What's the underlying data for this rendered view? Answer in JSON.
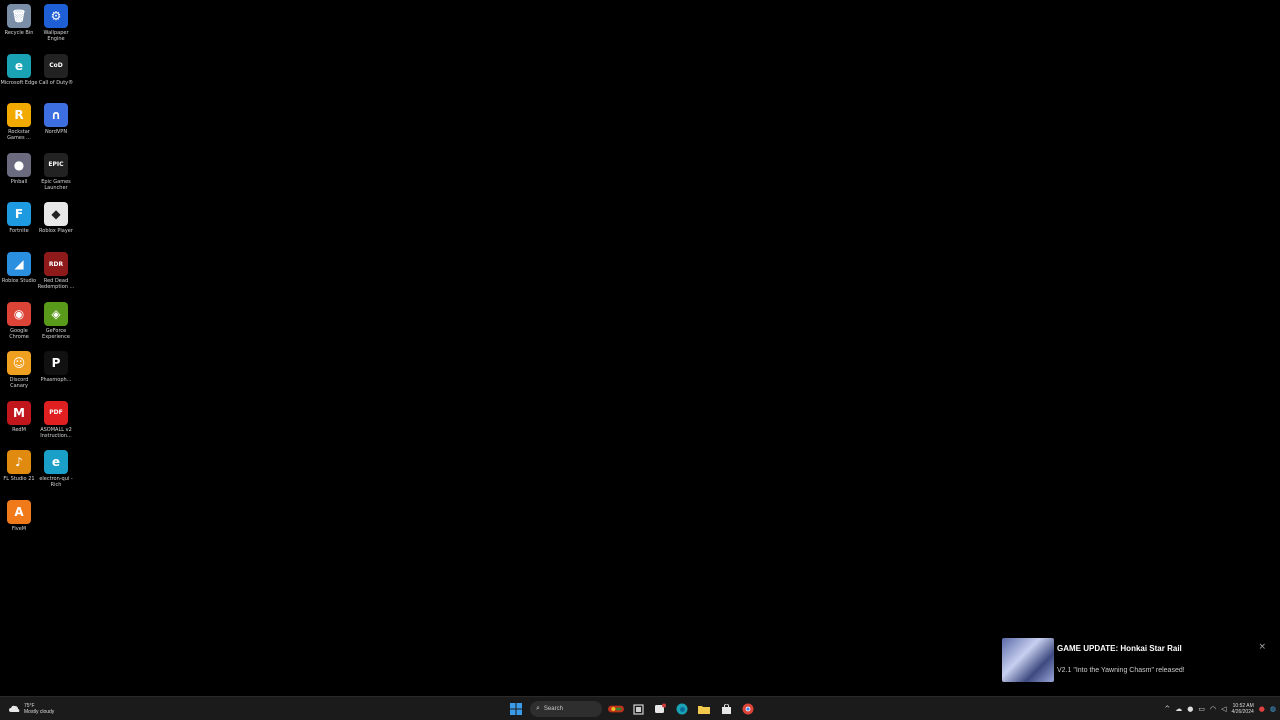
{
  "desktop": {
    "icons": [
      {
        "label": "Recycle Bin",
        "icon": "recycle-bin-icon",
        "glyph": "🗑",
        "color": "#7a8ea8"
      },
      {
        "label": "Wallpaper Engine",
        "icon": "wallpaper-engine-icon",
        "glyph": "⚙",
        "color": "#1f5fd6"
      },
      {
        "label": "Microsoft Edge",
        "icon": "edge-icon",
        "glyph": "e",
        "color": "#1aa3b5"
      },
      {
        "label": "Call of Duty®",
        "icon": "call-of-duty-icon",
        "glyph": "CoD",
        "color": "#222222"
      },
      {
        "label": "Rockstar Games ...",
        "icon": "rockstar-icon",
        "glyph": "R",
        "color": "#f2a900"
      },
      {
        "label": "NordVPN",
        "icon": "nordvpn-icon",
        "glyph": "∩",
        "color": "#3e6fe0"
      },
      {
        "label": "Pinball",
        "icon": "pinball-icon",
        "glyph": "●",
        "color": "#6b6b80"
      },
      {
        "label": "Epic Games Launcher",
        "icon": "epic-games-icon",
        "glyph": "EPIC",
        "color": "#222222"
      },
      {
        "label": "Fortnite",
        "icon": "fortnite-icon",
        "glyph": "F",
        "color": "#1e9be0"
      },
      {
        "label": "Roblox Player",
        "icon": "roblox-player-icon",
        "glyph": "◆",
        "color": "#e8e8e8"
      },
      {
        "label": "Roblox Studio",
        "icon": "roblox-studio-icon",
        "glyph": "◢",
        "color": "#2b8fe0"
      },
      {
        "label": "Red Dead Redemption ...",
        "icon": "red-dead-icon",
        "glyph": "RDR",
        "color": "#8e1a1a"
      },
      {
        "label": "Google Chrome",
        "icon": "chrome-icon",
        "glyph": "◉",
        "color": "#db4437"
      },
      {
        "label": "GeForce Experience",
        "icon": "geforce-icon",
        "glyph": "◈",
        "color": "#5a9a1a"
      },
      {
        "label": "Discord Canary",
        "icon": "discord-icon",
        "glyph": "☺",
        "color": "#f0a020"
      },
      {
        "label": "Phasmoph...",
        "icon": "phasmophobia-icon",
        "glyph": "P",
        "color": "#111111"
      },
      {
        "label": "RedM",
        "icon": "redm-icon",
        "glyph": "M",
        "color": "#c0161c"
      },
      {
        "label": "ASOMALL v2 Instruction...",
        "icon": "pdf-document-icon",
        "glyph": "PDF",
        "color": "#e02020"
      },
      {
        "label": "FL Studio 21",
        "icon": "fl-studio-icon",
        "glyph": "♪",
        "color": "#e08a10"
      },
      {
        "label": "electron-qui - Rich",
        "icon": "electron-app-icon",
        "glyph": "e",
        "color": "#1aa0c8"
      },
      {
        "label": "FiveM",
        "icon": "fivem-icon",
        "glyph": "A",
        "color": "#f07a1a"
      }
    ]
  },
  "toast": {
    "title": "GAME UPDATE: Honkai Star Rail",
    "body": "V2.1 \"Into the Yawning Chasm\" released!",
    "close": "×"
  },
  "taskbar": {
    "weather_temp": "75°F",
    "weather_desc": "Mostly cloudy",
    "search_placeholder": "Search",
    "tray_chevron": "^",
    "time": "10:52 AM",
    "date": "4/26/2024"
  },
  "colors": {
    "taskbar_bg": "#1b1b1b",
    "desktop_bg": "#000000",
    "accent": "#0078d4"
  }
}
